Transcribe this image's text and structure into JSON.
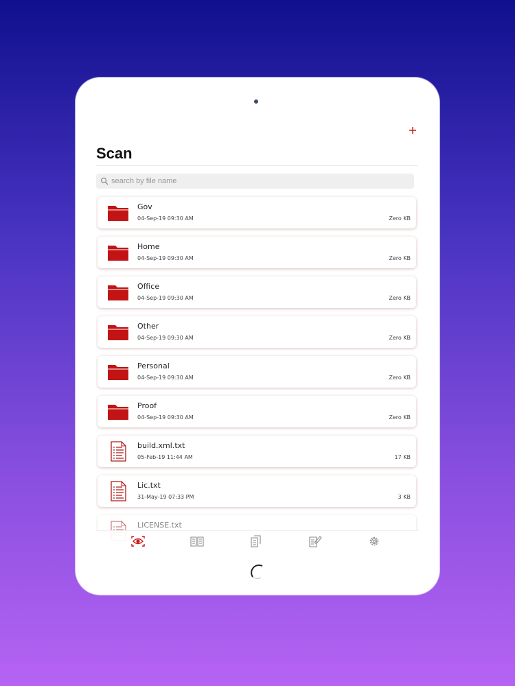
{
  "screen": {
    "title": "Scan",
    "add_icon": "plus-icon",
    "search": {
      "placeholder": "search by file name",
      "value": ""
    }
  },
  "colors": {
    "accent": "#c81a1a",
    "background_top": "#10108e",
    "background_bottom": "#b663f2"
  },
  "files": [
    {
      "name": "Gov",
      "date": "04-Sep-19 09:30 AM",
      "size": "Zero KB",
      "kind": "folder"
    },
    {
      "name": "Home",
      "date": "04-Sep-19 09:30 AM",
      "size": "Zero KB",
      "kind": "folder"
    },
    {
      "name": "Office",
      "date": "04-Sep-19 09:30 AM",
      "size": "Zero KB",
      "kind": "folder"
    },
    {
      "name": "Other",
      "date": "04-Sep-19 09:30 AM",
      "size": "Zero KB",
      "kind": "folder"
    },
    {
      "name": "Personal",
      "date": "04-Sep-19 09:30 AM",
      "size": "Zero KB",
      "kind": "folder"
    },
    {
      "name": "Proof",
      "date": "04-Sep-19 09:30 AM",
      "size": "Zero KB",
      "kind": "folder"
    },
    {
      "name": "build.xml.txt",
      "date": "05-Feb-19 11:44 AM",
      "size": "17 KB",
      "kind": "document"
    },
    {
      "name": "Lic.txt",
      "date": "31-May-19 07:33 PM",
      "size": "3 KB",
      "kind": "document"
    },
    {
      "name": "LICENSE.txt",
      "date": "",
      "size": "",
      "kind": "document"
    }
  ],
  "tabbar": {
    "tabs": [
      {
        "icon": "scan-eye-icon",
        "active": true
      },
      {
        "icon": "book-icon",
        "active": false
      },
      {
        "icon": "documents-icon",
        "active": false
      },
      {
        "icon": "edit-notes-icon",
        "active": false
      },
      {
        "icon": "gear-icon",
        "active": false
      }
    ]
  }
}
